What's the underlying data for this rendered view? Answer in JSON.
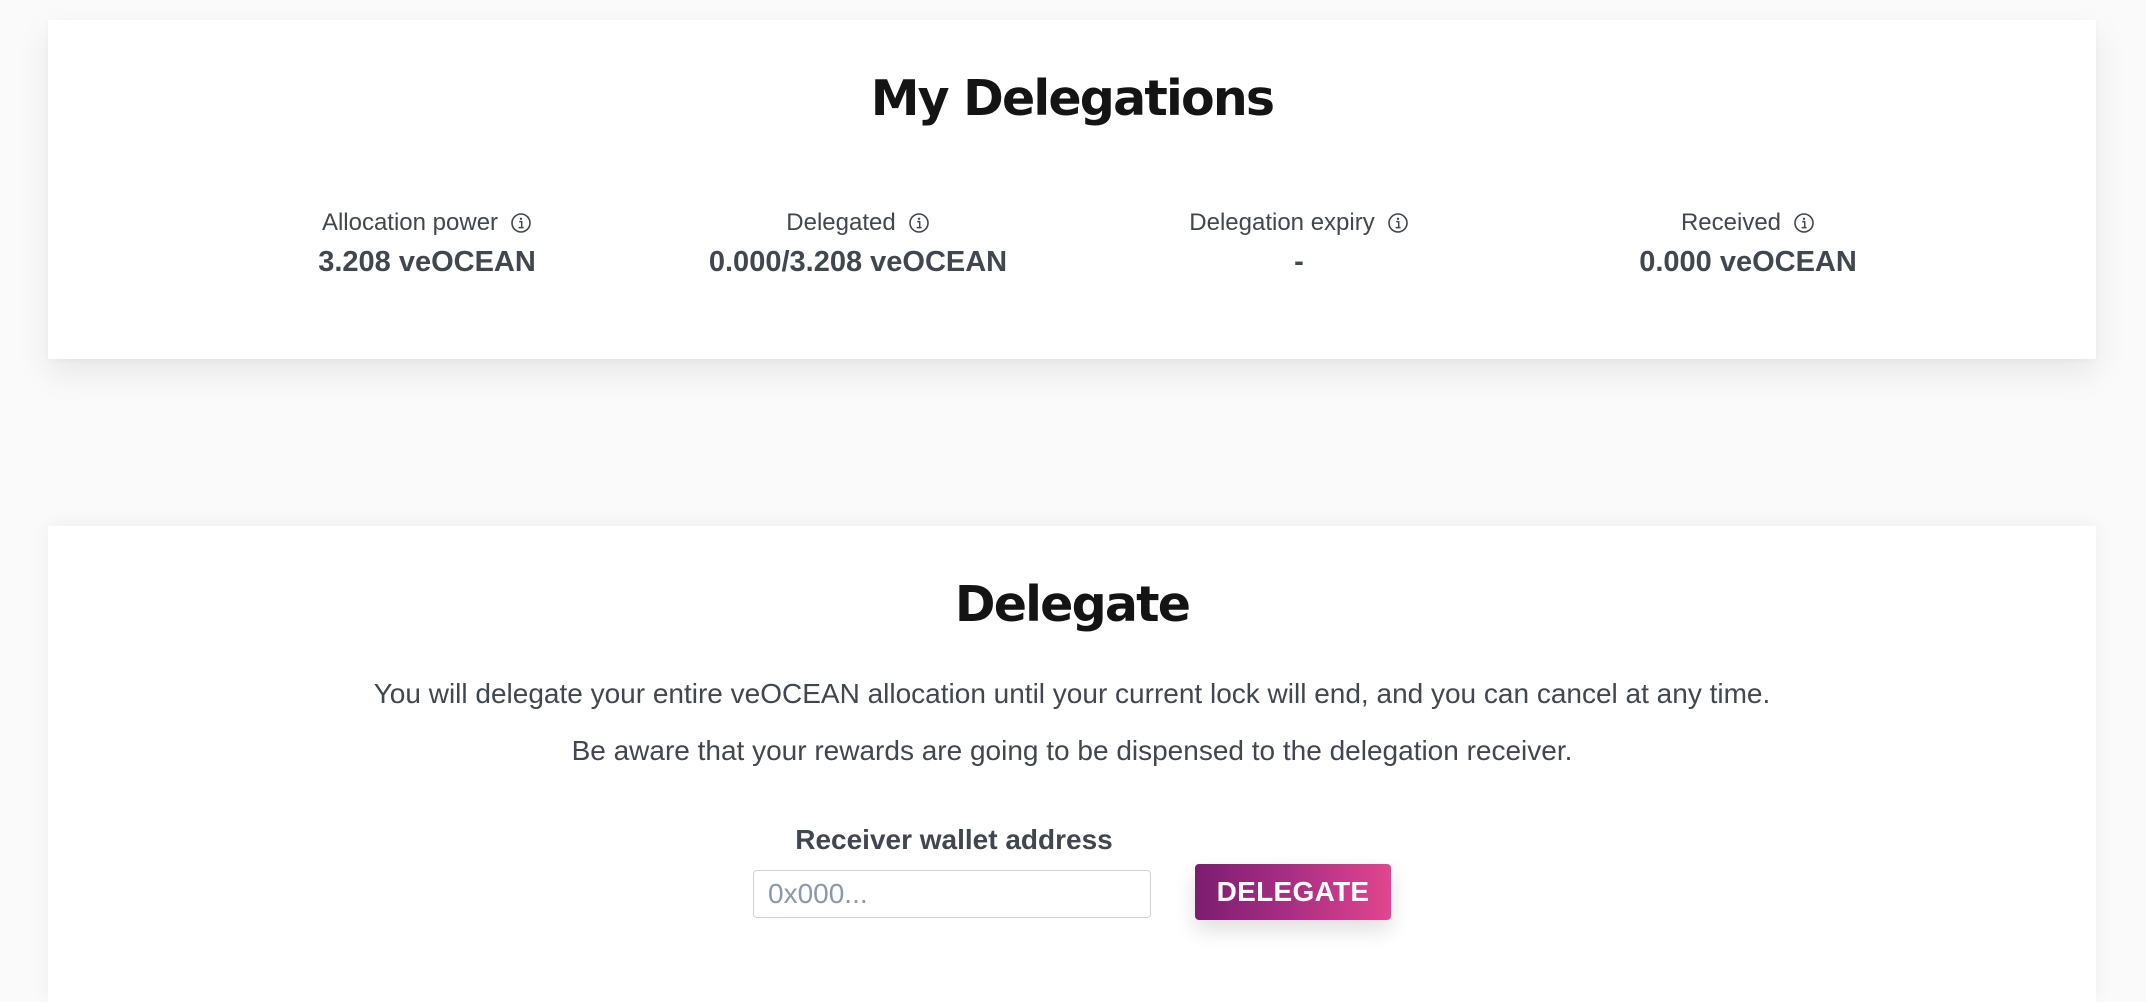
{
  "my_delegations": {
    "title": "My Delegations",
    "stats": [
      {
        "label": "Allocation power",
        "value": "3.208 veOCEAN",
        "icon": "info-icon"
      },
      {
        "label": "Delegated",
        "value": "0.000/3.208 veOCEAN",
        "icon": "info-icon"
      },
      {
        "label": "Delegation expiry",
        "value": "-",
        "icon": "info-icon"
      },
      {
        "label": "Received",
        "value": "0.000 veOCEAN",
        "icon": "info-icon"
      }
    ]
  },
  "delegate": {
    "title": "Delegate",
    "description_1": "You will delegate your entire veOCEAN allocation until your current lock will end, and you can cancel at any time.",
    "description_2": "Be aware that your rewards are going to be dispensed to the delegation receiver.",
    "receiver_label": "Receiver wallet address",
    "receiver_value": "",
    "receiver_placeholder": "0x000...",
    "button_label": "DELEGATE"
  },
  "colors": {
    "button_gradient_start": "#7b1d70",
    "button_gradient_end": "#e2458e",
    "text": "#41474e",
    "heading": "#141414",
    "background": "#fafafa",
    "card": "#ffffff"
  }
}
